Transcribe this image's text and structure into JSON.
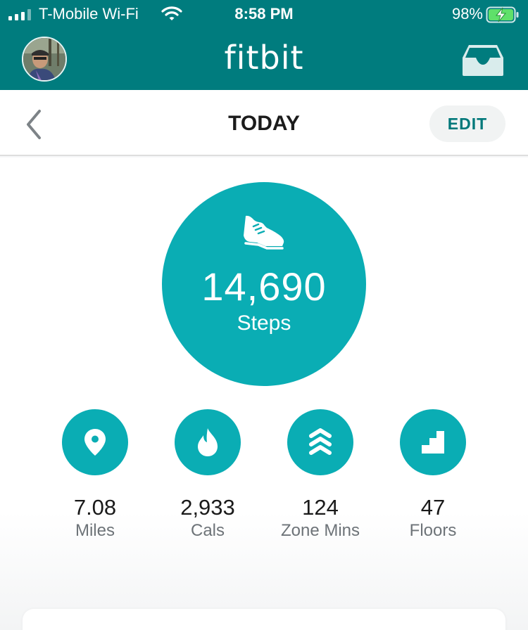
{
  "status_bar": {
    "carrier": "T-Mobile Wi-Fi",
    "time": "8:58 PM",
    "battery_percent": "98%"
  },
  "header": {
    "brand": "fitbit"
  },
  "date_nav": {
    "title": "TODAY",
    "edit_label": "EDIT"
  },
  "steps": {
    "value": "14,690",
    "label": "Steps"
  },
  "stats": [
    {
      "value": "7.08",
      "label": "Miles",
      "icon": "location-pin-icon"
    },
    {
      "value": "2,933",
      "label": "Cals",
      "icon": "flame-icon"
    },
    {
      "value": "124",
      "label": "Zone Mins",
      "icon": "chevrons-up-icon"
    },
    {
      "value": "47",
      "label": "Floors",
      "icon": "stairs-icon"
    }
  ],
  "colors": {
    "header_bg": "#007c7e",
    "accent": "#0aadb4",
    "edit_text": "#00787a"
  }
}
